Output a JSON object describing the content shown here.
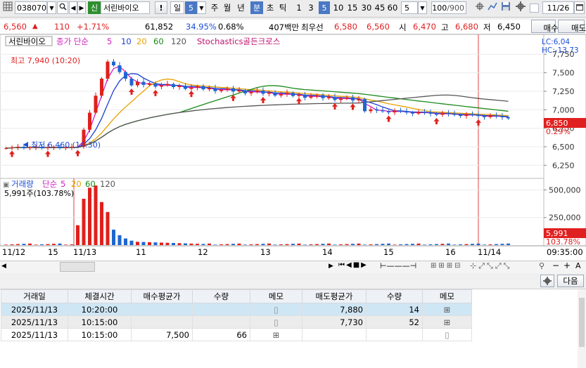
{
  "toolbar": {
    "code": "038070",
    "new_badge": "신",
    "stock_name": "서린바이오",
    "exclaim": "!",
    "period_day": "일",
    "day_count": "5",
    "period_week": "주",
    "period_month": "월",
    "period_year": "년",
    "period_min": "분",
    "period_sec": "초",
    "period_tick": "틱",
    "intervals": [
      "1",
      "3",
      "5",
      "10",
      "15",
      "30",
      "45",
      "60"
    ],
    "interval_selected": "5",
    "interval_count": "5",
    "zoom": "100",
    "zoom_total": "/900",
    "date": "11/26"
  },
  "quote": {
    "price": "6,560",
    "change_mark": "▲",
    "change": "110",
    "change_pct": "+1.71%",
    "volume": "61,852",
    "ratio": "34.95%",
    "ratio2": "0.68%",
    "amount": "407백만",
    "best_label": "최우선",
    "best_ask": "6,580",
    "best_bid": "6,560",
    "open_label": "시",
    "open": "6,470",
    "high_label": "고",
    "high": "6,680",
    "low_label": "저",
    "low": "6,450",
    "buy_button": "매수",
    "sell_button": "매도"
  },
  "chart": {
    "price_legend": {
      "name": "서린바이오",
      "ma_label": "종가 단순",
      "ma5": "5",
      "ma10": "10",
      "ma20": "20",
      "ma60": "60",
      "ma120": "120",
      "indicator": "Stochastics골든크로스"
    },
    "lc": "LC:6,04",
    "hc": "HC:-13.73",
    "high_note": "최고 7,940 (10:20)",
    "low_note": "최저 6,460 (14:30)",
    "current_price": "6,850",
    "current_pct": "0.29%",
    "volume_legend": {
      "name": "거래량",
      "ma_label": "단순",
      "ma5": "5",
      "ma20": "20",
      "ma60": "60",
      "ma120": "120"
    },
    "volume_note": "5,991주(103.78%)",
    "current_volume": "5,991",
    "current_volume_pct": "103.78%",
    "current_time": "09:35:00",
    "x_labels": [
      "11/12",
      "15",
      "11/13",
      "11",
      "12",
      "13",
      "14",
      "15",
      "16",
      "11/14"
    ]
  },
  "chart_data": [
    {
      "type": "candlestick",
      "title": "서린바이오",
      "y_ticks": [
        6250,
        6500,
        6750,
        7000,
        7250,
        7500,
        7750
      ],
      "ylim": [
        6120,
        7980
      ],
      "current_price": 6850,
      "price_high": 7940,
      "price_low": 6460,
      "moving_averages": [
        "5",
        "10",
        "20",
        "60",
        "120"
      ],
      "colors": {
        "ma5": "#d020c0",
        "ma10": "#1c3fd0",
        "ma20": "#e8a000",
        "ma60": "#1a8a1a",
        "ma120": "#555555",
        "up": "#e0201c",
        "down": "#1e66d0"
      }
    },
    {
      "type": "bar",
      "title": "거래량",
      "y_ticks": [
        250000,
        500000
      ],
      "ylim": [
        0,
        560000
      ],
      "current_value": 5991
    }
  ],
  "nav": {
    "next_label": "다음"
  },
  "table": {
    "headers": [
      "거래일",
      "체결시간",
      "매수평균가",
      "수량",
      "메모",
      "매도평균가",
      "수량",
      "메모"
    ],
    "rows": [
      {
        "date": "2025/11/13",
        "time": "10:20:00",
        "buy_avg": "",
        "buy_qty": "",
        "sell_avg": "7,880",
        "sell_qty": "14"
      },
      {
        "date": "2025/11/13",
        "time": "10:15:00",
        "buy_avg": "",
        "buy_qty": "",
        "sell_avg": "7,730",
        "sell_qty": "52"
      },
      {
        "date": "2025/11/13",
        "time": "10:15:00",
        "buy_avg": "7,500",
        "buy_qty": "66",
        "sell_avg": "",
        "sell_qty": ""
      }
    ]
  }
}
